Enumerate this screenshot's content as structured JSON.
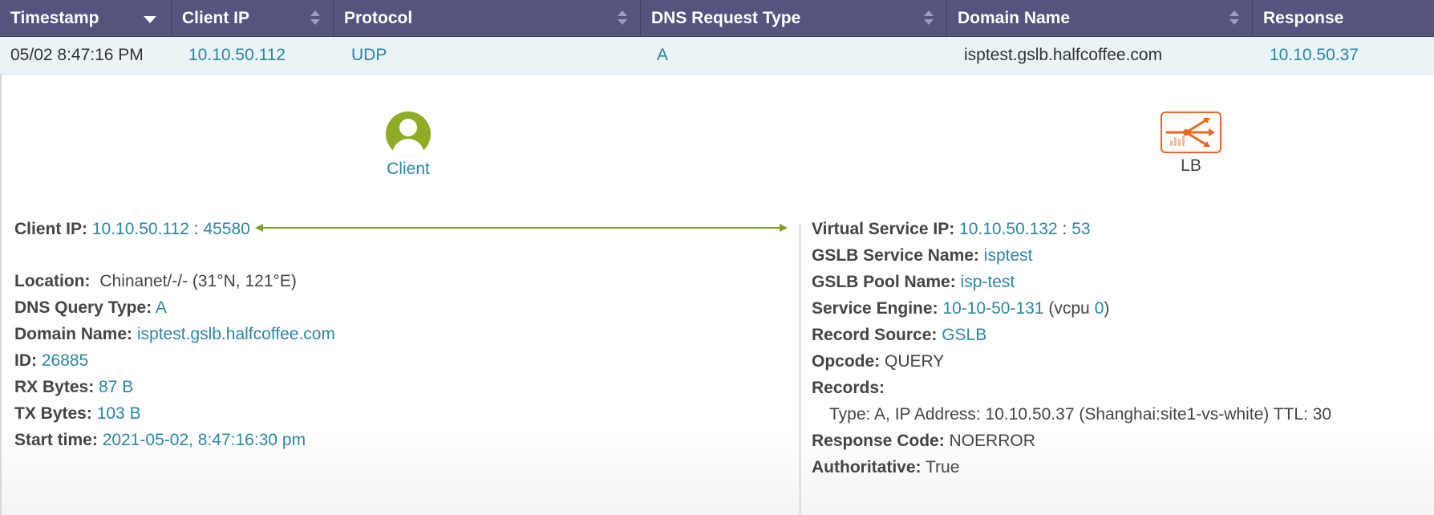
{
  "columns": [
    {
      "label": "Timestamp"
    },
    {
      "label": "Client IP"
    },
    {
      "label": "Protocol"
    },
    {
      "label": "DNS Request Type"
    },
    {
      "label": "Domain Name"
    },
    {
      "label": "Response"
    }
  ],
  "row": {
    "timestamp": "05/02 8:47:16 PM",
    "client_ip": "10.10.50.112",
    "protocol": "UDP",
    "dns_request_type": "A",
    "domain_name": "isptest.gslb.halfcoffee.com",
    "response": "10.10.50.37"
  },
  "client_node": {
    "label": "Client"
  },
  "lb_node": {
    "label": "LB"
  },
  "colors": {
    "header": "#54547e",
    "link": "#2b86a5",
    "client_icon": "#8fac26",
    "lb_icon": "#ee6620",
    "arrow": "#7f9e2a"
  },
  "client_details": {
    "client_ip_label": "Client IP:",
    "client_ip": "10.10.50.112",
    "sep": ":",
    "client_port": "45580",
    "location_label": "Location:",
    "location": "Chinanet/-/- (31°N, 121°E)",
    "dns_query_type_label": "DNS Query Type:",
    "dns_query_type": "A",
    "domain_name_label": "Domain Name:",
    "domain_name": "isptest.gslb.halfcoffee.com",
    "id_label": "ID:",
    "id": "26885",
    "rx_bytes_label": "RX Bytes:",
    "rx_bytes": "87 B",
    "tx_bytes_label": "TX Bytes:",
    "tx_bytes": "103 B",
    "start_time_label": "Start time:",
    "start_time": "2021-05-02, 8:47:16:30 pm"
  },
  "server_details": {
    "vs_ip_label": "Virtual Service IP:",
    "vs_ip": "10.10.50.132",
    "sep": ":",
    "vs_port": "53",
    "gslb_service_label": "GSLB Service Name:",
    "gslb_service": "isptest",
    "gslb_pool_label": "GSLB Pool Name:",
    "gslb_pool": "isp-test",
    "service_engine_label": "Service Engine:",
    "service_engine": "10-10-50-131",
    "vcpu_open": "(vcpu",
    "vcpu": "0",
    "vcpu_close": ")",
    "record_source_label": "Record Source:",
    "record_source": "GSLB",
    "opcode_label": "Opcode:",
    "opcode": "QUERY",
    "records_label": "Records:",
    "record_line": "Type: A, IP Address: 10.10.50.37 (Shanghai:site1-vs-white) TTL: 30",
    "response_code_label": "Response Code:",
    "response_code": "NOERROR",
    "authoritative_label": "Authoritative:",
    "authoritative": "True"
  }
}
